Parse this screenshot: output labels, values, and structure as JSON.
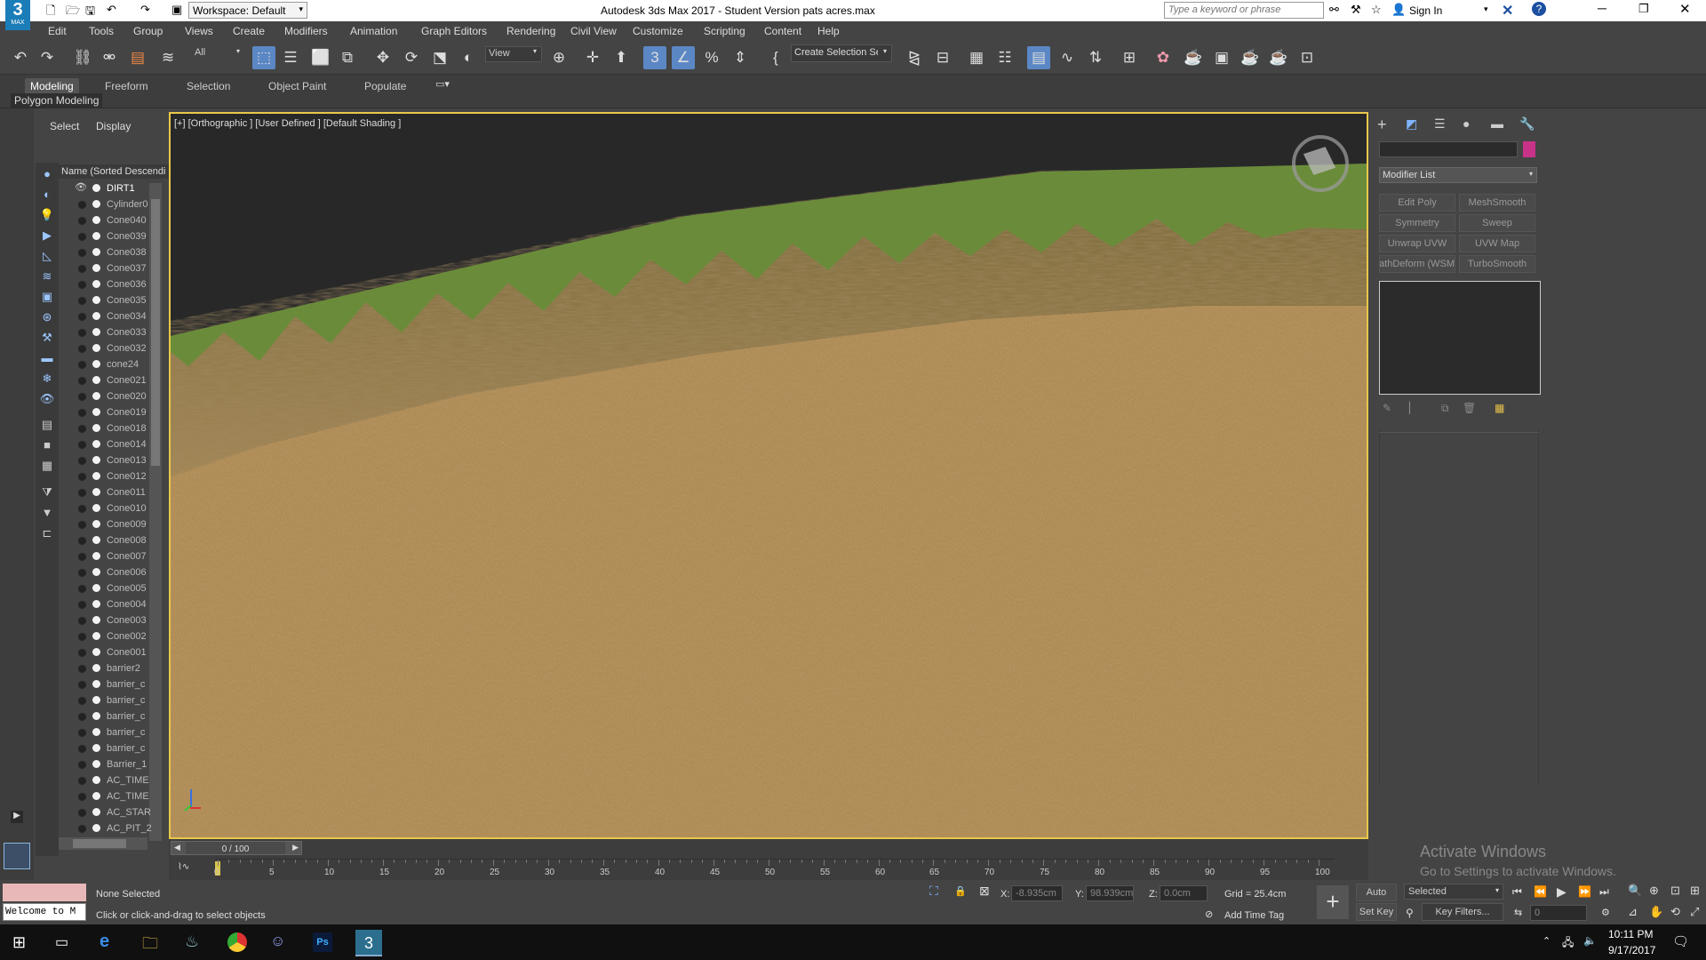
{
  "titlebar": {
    "workspace_label": "Workspace: Default",
    "title": "Autodesk 3ds Max 2017 - Student Version     pats acres.max",
    "search_placeholder": "Type a keyword or phrase",
    "sign_in": "Sign In",
    "app_badge": "MAX"
  },
  "menu": [
    "Edit",
    "Tools",
    "Group",
    "Views",
    "Create",
    "Modifiers",
    "Animation",
    "Graph Editors",
    "Rendering",
    "Civil View",
    "Customize",
    "Scripting",
    "Content",
    "Help"
  ],
  "toolbar": {
    "filter_value": "All",
    "refcoord_value": "View",
    "selection_set_value": "Create Selection Se"
  },
  "ribbon": {
    "tabs": [
      "Modeling",
      "Freeform",
      "Selection",
      "Object Paint",
      "Populate"
    ],
    "active_tab": "Modeling",
    "subtitle": "Polygon Modeling"
  },
  "scene_explorer": {
    "tab_select": "Select",
    "tab_display": "Display",
    "column_header": "Name (Sorted Descendi",
    "objects": [
      "DIRT1",
      "Cylinder0",
      "Cone040",
      "Cone039",
      "Cone038",
      "Cone037",
      "Cone036",
      "Cone035",
      "Cone034",
      "Cone033",
      "Cone032",
      "cone24",
      "Cone021",
      "Cone020",
      "Cone019",
      "Cone018",
      "Cone014",
      "Cone013",
      "Cone012",
      "Cone011",
      "Cone010",
      "Cone009",
      "Cone008",
      "Cone007",
      "Cone006",
      "Cone005",
      "Cone004",
      "Cone003",
      "Cone002",
      "Cone001",
      "barrier2",
      "barrier_c",
      "barrier_c",
      "barrier_c",
      "barrier_c",
      "barrier_c",
      "Barrier_1",
      "AC_TIME",
      "AC_TIME",
      "AC_STAR",
      "AC_PIT_2"
    ]
  },
  "viewport": {
    "label": "[+] [Orthographic ] [User Defined ] [Default Shading ]"
  },
  "command_panel": {
    "modifier_list": "Modifier List",
    "modifier_buttons": [
      "Edit Poly",
      "MeshSmooth",
      "Symmetry",
      "Sweep",
      "Unwrap UVW",
      "UVW Map",
      "PathDeform (WSM",
      "TurboSmooth"
    ],
    "accent_color": "#c8338a"
  },
  "timeline": {
    "frame_readout": "0 / 100",
    "ticks": [
      "0",
      "5",
      "10",
      "15",
      "20",
      "25",
      "30",
      "35",
      "40",
      "45",
      "50",
      "55",
      "60",
      "65",
      "70",
      "75",
      "80",
      "85",
      "90",
      "95",
      "100"
    ]
  },
  "status": {
    "listener_text": "Welcome to M",
    "selection_status": "None Selected",
    "prompt": "Click or click-and-drag to select objects",
    "x_label": "X:",
    "x_value": "-8.935cm",
    "y_label": "Y:",
    "y_value": "98.939cm",
    "z_label": "Z:",
    "z_value": "0.0cm",
    "grid": "Grid = 25.4cm",
    "add_time_tag": "Add Time Tag",
    "auto_key": "Auto Key",
    "set_key": "Set Key",
    "selected_dropdown": "Selected",
    "key_filters": "Key Filters...",
    "frame_field": "0"
  },
  "watermark": {
    "line1": "Activate Windows",
    "line2": "Go to Settings to activate Windows."
  },
  "taskbar": {
    "time": "10:11 PM",
    "date": "9/17/2017"
  }
}
